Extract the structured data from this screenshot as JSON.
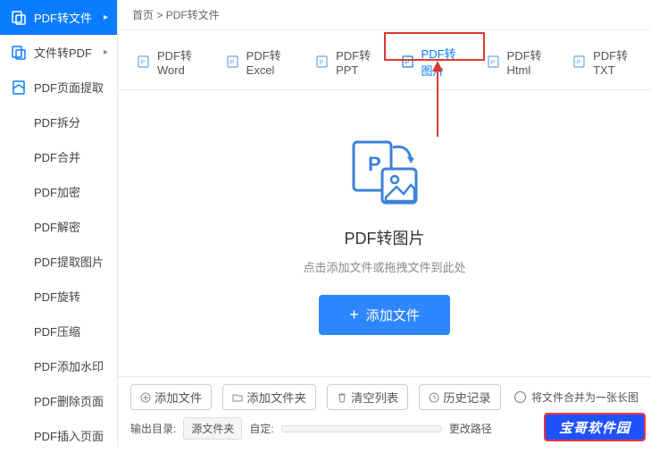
{
  "breadcrumb": {
    "home": "首页",
    "current": "PDF转文件"
  },
  "sidebar": {
    "main": [
      {
        "label": "PDF转文件",
        "active": true,
        "hasChevron": true
      },
      {
        "label": "文件转PDF",
        "hasChevron": true
      },
      {
        "label": "PDF页面提取"
      }
    ],
    "sub": [
      {
        "label": "PDF拆分"
      },
      {
        "label": "PDF合并"
      },
      {
        "label": "PDF加密"
      },
      {
        "label": "PDF解密"
      },
      {
        "label": "PDF提取图片"
      },
      {
        "label": "PDF旋转"
      },
      {
        "label": "PDF压缩"
      },
      {
        "label": "PDF添加水印"
      },
      {
        "label": "PDF删除页面"
      },
      {
        "label": "PDF插入页面"
      }
    ]
  },
  "tabs": [
    {
      "label": "PDF转Word"
    },
    {
      "label": "PDF转Excel"
    },
    {
      "label": "PDF转PPT"
    },
    {
      "label": "PDF转图片",
      "highlighted": true
    },
    {
      "label": "PDF转Html"
    },
    {
      "label": "PDF转TXT"
    }
  ],
  "hero": {
    "title": "PDF转图片",
    "subtitle": "点击添加文件或拖拽文件到此处",
    "button": "添加文件"
  },
  "bottom": {
    "add_file": "添加文件",
    "add_folder": "添加文件夹",
    "clear_list": "清空列表",
    "history": "历史记录",
    "merge_option": "将文件合并为一张长图",
    "output_label": "输出目录:",
    "source_folder": "源文件夹",
    "custom": "自定:",
    "change_path": "更改路径"
  },
  "watermark": "宝哥软件园"
}
